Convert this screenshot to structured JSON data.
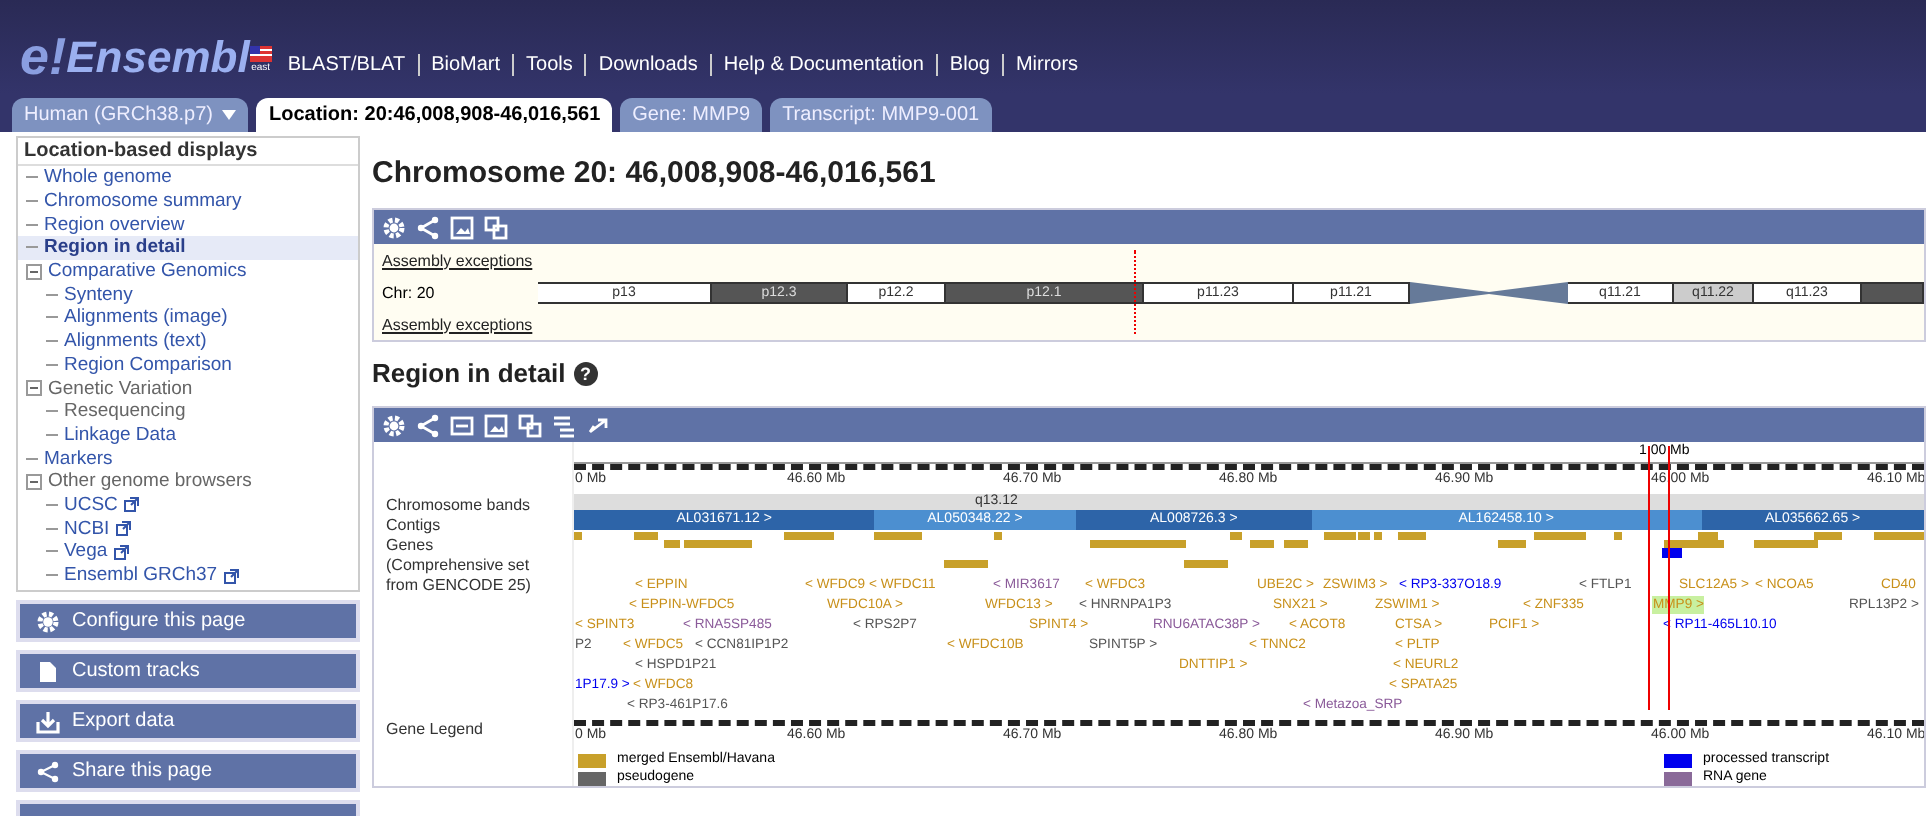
{
  "header": {
    "logo_mark": "e!",
    "logo_name": "Ensembl",
    "flag_caption": "east",
    "nav_links": [
      "BLAST/BLAT",
      "BioMart",
      "Tools",
      "Downloads",
      "Help & Documentation",
      "Blog",
      "Mirrors"
    ]
  },
  "tabs": [
    {
      "label": "Human (GRCh38.p7)",
      "kind": "species",
      "selected": false
    },
    {
      "label": "Location: 20:46,008,908-46,016,561",
      "kind": "page",
      "selected": true
    },
    {
      "label": "Gene: MMP9",
      "kind": "page",
      "selected": false
    },
    {
      "label": "Transcript: MMP9-001",
      "kind": "page",
      "selected": false
    }
  ],
  "sidebar": {
    "heading": "Location-based displays",
    "items": [
      {
        "label": "Whole genome",
        "selected": false,
        "disabled": false
      },
      {
        "label": "Chromosome summary",
        "selected": false,
        "disabled": false
      },
      {
        "label": "Region overview",
        "selected": false,
        "disabled": false
      },
      {
        "label": "Region in detail",
        "selected": true,
        "disabled": false
      },
      {
        "label": "Comparative Genomics",
        "selected": false,
        "disabled": false,
        "expanded": true,
        "children": [
          {
            "label": "Synteny",
            "selected": false,
            "disabled": false
          },
          {
            "label": "Alignments (image)",
            "selected": false,
            "disabled": false
          },
          {
            "label": "Alignments (text)",
            "selected": false,
            "disabled": false
          },
          {
            "label": "Region Comparison",
            "selected": false,
            "disabled": false
          }
        ]
      },
      {
        "label": "Genetic Variation",
        "selected": false,
        "disabled": true,
        "expanded": true,
        "children": [
          {
            "label": "Resequencing",
            "selected": false,
            "disabled": true
          },
          {
            "label": "Linkage Data",
            "selected": false,
            "disabled": false
          }
        ]
      },
      {
        "label": "Markers",
        "selected": false,
        "disabled": false
      },
      {
        "label": "Other genome browsers",
        "selected": false,
        "disabled": true,
        "expanded": true,
        "children": [
          {
            "label": "UCSC",
            "selected": false,
            "disabled": false,
            "external": true
          },
          {
            "label": "NCBI",
            "selected": false,
            "disabled": false,
            "external": true
          },
          {
            "label": "Vega",
            "selected": false,
            "disabled": false,
            "external": true
          },
          {
            "label": "Ensembl GRCh37",
            "selected": false,
            "disabled": false,
            "external": true
          }
        ]
      }
    ],
    "actions": [
      {
        "label": "Configure this page",
        "kind": "gear"
      },
      {
        "label": "Custom tracks",
        "kind": "tracks"
      },
      {
        "label": "Export data",
        "kind": "export"
      },
      {
        "label": "Share this page",
        "kind": "share"
      }
    ]
  },
  "main": {
    "title": "Chromosome 20: 46,008,908-46,016,561",
    "chromosome_panel": {
      "labels": [
        "Assembly exceptions",
        "Chr: 20",
        "Assembly exceptions"
      ],
      "bands": [
        {
          "label": "p13",
          "kind": "light"
        },
        {
          "label": "p12.3",
          "kind": "dark"
        },
        {
          "label": "p12.2",
          "kind": "light"
        },
        {
          "label": "p12.1",
          "kind": "dark"
        },
        {
          "label": "p11.23",
          "kind": "light"
        },
        {
          "label": "p11.21",
          "kind": "light"
        },
        {
          "kind": "centromere"
        },
        {
          "label": "q11.21",
          "kind": "light"
        },
        {
          "label": "q11.22",
          "kind": "grey"
        },
        {
          "label": "q11.23",
          "kind": "light"
        },
        {
          "kind": "dark"
        }
      ]
    },
    "region_panel": {
      "title": "Region in detail",
      "help_mark": "?",
      "scale": "1.00 Mb",
      "ticks_top": [
        "0 Mb",
        "46.60 Mb",
        "46.70 Mb",
        "46.80 Mb",
        "46.90 Mb",
        "46.00 Mb",
        "46.10 Mb"
      ],
      "ticks_bottom": [
        "0 Mb",
        "46.60 Mb",
        "46.70 Mb",
        "46.80 Mb",
        "46.90 Mb",
        "46.00 Mb",
        "46.10 Mb"
      ],
      "track_labels": [
        "Chromosome bands",
        "Contigs",
        "Genes\n(Comprehensive set\nfrom GENCODE 25)"
      ],
      "band_label": "q13.12",
      "contigs": [
        "AL031671.12 >",
        "AL050348.22 >",
        "AL008726.3 >",
        "AL162458.10 >",
        "AL035662.65 >"
      ],
      "gene_rows": [
        [
          {
            "label": "< EPPIN",
            "kind": "merged",
            "highlighted": false
          },
          {
            "label": "< WFDC9",
            "kind": "merged",
            "highlighted": false
          },
          {
            "label": "< WFDC11",
            "kind": "merged",
            "highlighted": false
          },
          {
            "label": "< MIR3617",
            "kind": "rna",
            "highlighted": false
          },
          {
            "label": "< WFDC3",
            "kind": "merged",
            "highlighted": false
          },
          {
            "label": "UBE2C >",
            "kind": "merged",
            "highlighted": false
          },
          {
            "label": "ZSWIM3 >",
            "kind": "merged",
            "highlighted": false
          },
          {
            "label": "< RP3-337O18.9",
            "kind": "processed",
            "highlighted": false
          },
          {
            "label": "< FTLP1",
            "kind": "pseudogene",
            "highlighted": false
          },
          {
            "label": "SLC12A5 >",
            "kind": "merged",
            "highlighted": false
          },
          {
            "label": "< NCOA5",
            "kind": "merged",
            "highlighted": false
          },
          {
            "label": "CD40",
            "kind": "merged",
            "highlighted": false
          }
        ],
        [
          {
            "label": "< EPPIN-WFDC5",
            "kind": "merged",
            "highlighted": false
          },
          {
            "label": "WFDC10A >",
            "kind": "merged",
            "highlighted": false
          },
          {
            "label": "WFDC13 >",
            "kind": "merged",
            "highlighted": false
          },
          {
            "label": "< HNRNPA1P3",
            "kind": "pseudogene",
            "highlighted": false
          },
          {
            "label": "SNX21 >",
            "kind": "merged",
            "highlighted": false
          },
          {
            "label": "ZSWIM1 >",
            "kind": "merged",
            "highlighted": false
          },
          {
            "label": "< ZNF335",
            "kind": "merged",
            "highlighted": false
          },
          {
            "label": "MMP9 >",
            "kind": "merged",
            "highlighted": true
          },
          {
            "label": "RPL13P2 >",
            "kind": "pseudogene",
            "highlighted": false
          }
        ],
        [
          {
            "label": "< SPINT3",
            "kind": "merged",
            "highlighted": false
          },
          {
            "label": "< RNA5SP485",
            "kind": "rna",
            "highlighted": false
          },
          {
            "label": "< RPS2P7",
            "kind": "pseudogene",
            "highlighted": false
          },
          {
            "label": "SPINT4 >",
            "kind": "merged",
            "highlighted": false
          },
          {
            "label": "RNU6ATAC38P >",
            "kind": "rna",
            "highlighted": false
          },
          {
            "label": "< ACOT8",
            "kind": "merged",
            "highlighted": false
          },
          {
            "label": "CTSA >",
            "kind": "merged",
            "highlighted": false
          },
          {
            "label": "PCIF1 >",
            "kind": "merged",
            "highlighted": false
          },
          {
            "label": "< RP11-465L10.10",
            "kind": "processed",
            "highlighted": false
          }
        ],
        [
          {
            "label": "P2",
            "kind": "pseudogene",
            "highlighted": false
          },
          {
            "label": "< WFDC5",
            "kind": "merged",
            "highlighted": false
          },
          {
            "label": "< CCN81IP1P2",
            "kind": "pseudogene",
            "highlighted": false
          },
          {
            "label": "< WFDC10B",
            "kind": "merged",
            "highlighted": false
          },
          {
            "label": "SPINT5P >",
            "kind": "pseudogene",
            "highlighted": false
          },
          {
            "label": "< TNNC2",
            "kind": "merged",
            "highlighted": false
          },
          {
            "label": "< PLTP",
            "kind": "merged",
            "highlighted": false
          }
        ],
        [
          {
            "label": "< HSPD1P21",
            "kind": "pseudogene",
            "highlighted": false
          },
          {
            "label": "DNTTIP1 >",
            "kind": "merged",
            "highlighted": false
          },
          {
            "label": "< NEURL2",
            "kind": "merged",
            "highlighted": false
          }
        ],
        [
          {
            "label": "1P17.9 >",
            "kind": "processed",
            "highlighted": false
          },
          {
            "label": "< WFDC8",
            "kind": "merged",
            "highlighted": false
          },
          {
            "label": "< SPATA25",
            "kind": "merged",
            "highlighted": false
          }
        ],
        [
          {
            "label": "< RP3-461P17.6",
            "kind": "pseudogene",
            "highlighted": false
          },
          {
            "label": "< Metazoa_SRP",
            "kind": "rna",
            "highlighted": false
          }
        ]
      ],
      "legend_label": "Gene Legend",
      "legend": [
        {
          "label": "merged Ensembl/Havana",
          "color": "#c8a02a"
        },
        {
          "label": "pseudogene",
          "color": "#666666"
        },
        {
          "label": "processed transcript",
          "color": "#0000ee"
        },
        {
          "label": "RNA gene",
          "color": "#8a6a99"
        }
      ]
    }
  }
}
